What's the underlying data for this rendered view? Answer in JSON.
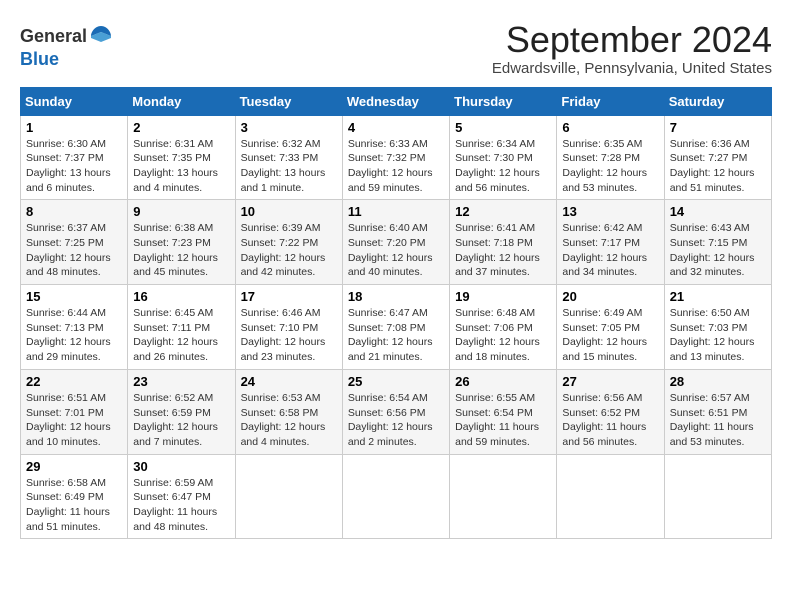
{
  "header": {
    "logo_line1": "General",
    "logo_line2": "Blue",
    "month_title": "September 2024",
    "location": "Edwardsville, Pennsylvania, United States"
  },
  "days_of_week": [
    "Sunday",
    "Monday",
    "Tuesday",
    "Wednesday",
    "Thursday",
    "Friday",
    "Saturday"
  ],
  "weeks": [
    [
      {
        "day": "1",
        "info": "Sunrise: 6:30 AM\nSunset: 7:37 PM\nDaylight: 13 hours\nand 6 minutes."
      },
      {
        "day": "2",
        "info": "Sunrise: 6:31 AM\nSunset: 7:35 PM\nDaylight: 13 hours\nand 4 minutes."
      },
      {
        "day": "3",
        "info": "Sunrise: 6:32 AM\nSunset: 7:33 PM\nDaylight: 13 hours\nand 1 minute."
      },
      {
        "day": "4",
        "info": "Sunrise: 6:33 AM\nSunset: 7:32 PM\nDaylight: 12 hours\nand 59 minutes."
      },
      {
        "day": "5",
        "info": "Sunrise: 6:34 AM\nSunset: 7:30 PM\nDaylight: 12 hours\nand 56 minutes."
      },
      {
        "day": "6",
        "info": "Sunrise: 6:35 AM\nSunset: 7:28 PM\nDaylight: 12 hours\nand 53 minutes."
      },
      {
        "day": "7",
        "info": "Sunrise: 6:36 AM\nSunset: 7:27 PM\nDaylight: 12 hours\nand 51 minutes."
      }
    ],
    [
      {
        "day": "8",
        "info": "Sunrise: 6:37 AM\nSunset: 7:25 PM\nDaylight: 12 hours\nand 48 minutes."
      },
      {
        "day": "9",
        "info": "Sunrise: 6:38 AM\nSunset: 7:23 PM\nDaylight: 12 hours\nand 45 minutes."
      },
      {
        "day": "10",
        "info": "Sunrise: 6:39 AM\nSunset: 7:22 PM\nDaylight: 12 hours\nand 42 minutes."
      },
      {
        "day": "11",
        "info": "Sunrise: 6:40 AM\nSunset: 7:20 PM\nDaylight: 12 hours\nand 40 minutes."
      },
      {
        "day": "12",
        "info": "Sunrise: 6:41 AM\nSunset: 7:18 PM\nDaylight: 12 hours\nand 37 minutes."
      },
      {
        "day": "13",
        "info": "Sunrise: 6:42 AM\nSunset: 7:17 PM\nDaylight: 12 hours\nand 34 minutes."
      },
      {
        "day": "14",
        "info": "Sunrise: 6:43 AM\nSunset: 7:15 PM\nDaylight: 12 hours\nand 32 minutes."
      }
    ],
    [
      {
        "day": "15",
        "info": "Sunrise: 6:44 AM\nSunset: 7:13 PM\nDaylight: 12 hours\nand 29 minutes."
      },
      {
        "day": "16",
        "info": "Sunrise: 6:45 AM\nSunset: 7:11 PM\nDaylight: 12 hours\nand 26 minutes."
      },
      {
        "day": "17",
        "info": "Sunrise: 6:46 AM\nSunset: 7:10 PM\nDaylight: 12 hours\nand 23 minutes."
      },
      {
        "day": "18",
        "info": "Sunrise: 6:47 AM\nSunset: 7:08 PM\nDaylight: 12 hours\nand 21 minutes."
      },
      {
        "day": "19",
        "info": "Sunrise: 6:48 AM\nSunset: 7:06 PM\nDaylight: 12 hours\nand 18 minutes."
      },
      {
        "day": "20",
        "info": "Sunrise: 6:49 AM\nSunset: 7:05 PM\nDaylight: 12 hours\nand 15 minutes."
      },
      {
        "day": "21",
        "info": "Sunrise: 6:50 AM\nSunset: 7:03 PM\nDaylight: 12 hours\nand 13 minutes."
      }
    ],
    [
      {
        "day": "22",
        "info": "Sunrise: 6:51 AM\nSunset: 7:01 PM\nDaylight: 12 hours\nand 10 minutes."
      },
      {
        "day": "23",
        "info": "Sunrise: 6:52 AM\nSunset: 6:59 PM\nDaylight: 12 hours\nand 7 minutes."
      },
      {
        "day": "24",
        "info": "Sunrise: 6:53 AM\nSunset: 6:58 PM\nDaylight: 12 hours\nand 4 minutes."
      },
      {
        "day": "25",
        "info": "Sunrise: 6:54 AM\nSunset: 6:56 PM\nDaylight: 12 hours\nand 2 minutes."
      },
      {
        "day": "26",
        "info": "Sunrise: 6:55 AM\nSunset: 6:54 PM\nDaylight: 11 hours\nand 59 minutes."
      },
      {
        "day": "27",
        "info": "Sunrise: 6:56 AM\nSunset: 6:52 PM\nDaylight: 11 hours\nand 56 minutes."
      },
      {
        "day": "28",
        "info": "Sunrise: 6:57 AM\nSunset: 6:51 PM\nDaylight: 11 hours\nand 53 minutes."
      }
    ],
    [
      {
        "day": "29",
        "info": "Sunrise: 6:58 AM\nSunset: 6:49 PM\nDaylight: 11 hours\nand 51 minutes."
      },
      {
        "day": "30",
        "info": "Sunrise: 6:59 AM\nSunset: 6:47 PM\nDaylight: 11 hours\nand 48 minutes."
      },
      null,
      null,
      null,
      null,
      null
    ]
  ]
}
